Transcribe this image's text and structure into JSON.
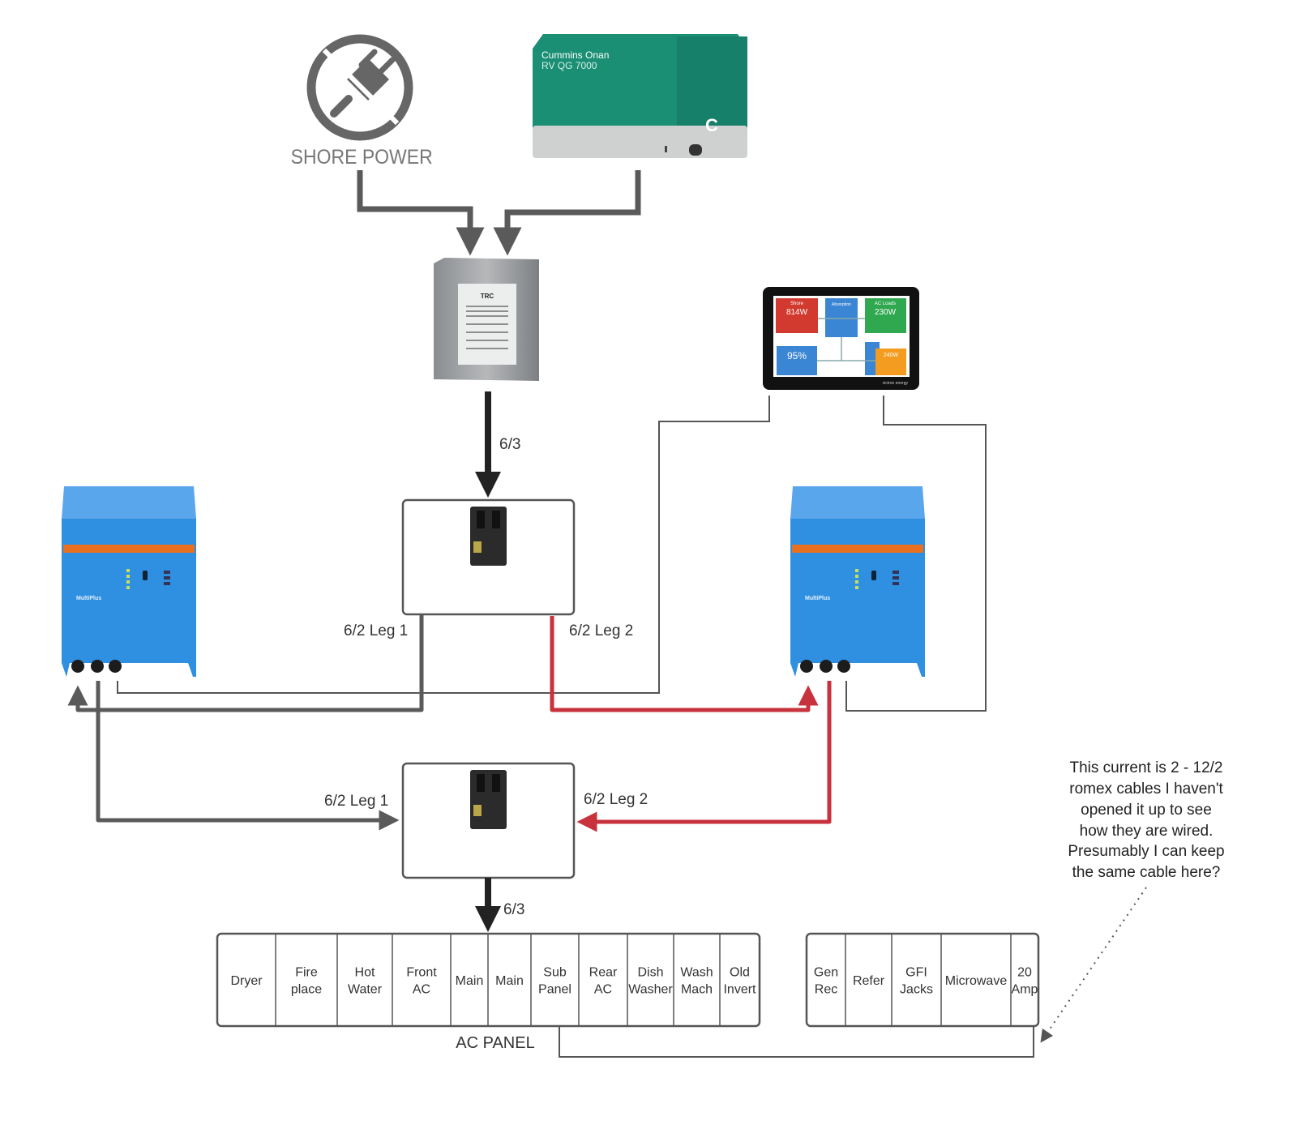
{
  "sources": {
    "shore_power": {
      "label": "SHORE POWER",
      "icon": "no-plug-icon"
    },
    "generator": {
      "brand": "Cummins Onan",
      "model": "RV QG 7000",
      "color": "#1a8f73"
    }
  },
  "transfer_switch": {
    "brand": "TRC",
    "icon": "transfer-switch"
  },
  "monitor": {
    "shore": "Shore",
    "shore_value": "814W",
    "state": "Absorption",
    "ac_loads": "AC Loads",
    "ac_loads_value": "230W",
    "battery_value": "95%",
    "dc_value": "240W",
    "logo": "victron energy"
  },
  "inverters": {
    "model": "MultiPlus",
    "color": "#2f8fe0",
    "stripe": "#e8701f"
  },
  "wires": {
    "top_feed": "6/3",
    "top_leg1": "6/2 Leg 1",
    "top_leg2": "6/2 Leg 2",
    "bottom_leg1": "6/2 Leg 1",
    "bottom_leg2": "6/2 Leg 2",
    "bottom_feed": "6/3",
    "gray_color": "#5a5a5a",
    "red_color": "#c8323c"
  },
  "ac_panel": {
    "label": "AC PANEL",
    "main_cells": [
      [
        "Dryer"
      ],
      [
        "Fire",
        "place"
      ],
      [
        "Hot",
        "Water"
      ],
      [
        "Front",
        "AC"
      ],
      [
        "Main"
      ],
      [
        "Main"
      ],
      [
        "Sub",
        "Panel"
      ],
      [
        "Rear",
        "AC"
      ],
      [
        "Dish",
        "Washer"
      ],
      [
        "Wash",
        "Mach"
      ],
      [
        "Old",
        "Invert"
      ]
    ],
    "side_cells": [
      [
        "Gen",
        "Rec"
      ],
      [
        "Refer"
      ],
      [
        "GFI",
        "Jacks"
      ],
      [
        "Microwave"
      ],
      [
        "20",
        "Amp"
      ]
    ]
  },
  "note": {
    "lines": [
      "This current is 2 - 12/2",
      "romex cables I haven't",
      "opened it up to see",
      "how they are wired.",
      "Presumably I can keep",
      "the same cable here?"
    ]
  }
}
